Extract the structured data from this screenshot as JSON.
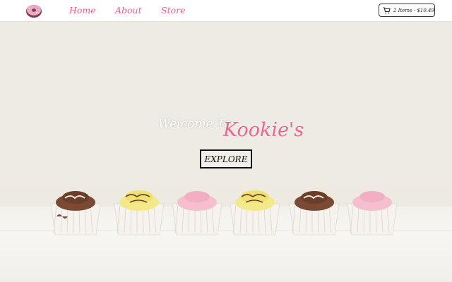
{
  "nav": {
    "links": [
      {
        "label": "Home"
      },
      {
        "label": "About"
      },
      {
        "label": "Store"
      }
    ],
    "cart_label": "2 Items - $10.49"
  },
  "hero": {
    "welcome": "Welcome To",
    "brand": "Kookie's",
    "cta": "EXPLORE"
  },
  "colors": {
    "accent": "#e0608c",
    "brand_pink": "#e86a96",
    "nav_bg": "#ffffff",
    "hero_bg": "#eeebe3"
  },
  "icons": {
    "logo": "donut-logo-icon",
    "cart": "shopping-cart-icon"
  }
}
